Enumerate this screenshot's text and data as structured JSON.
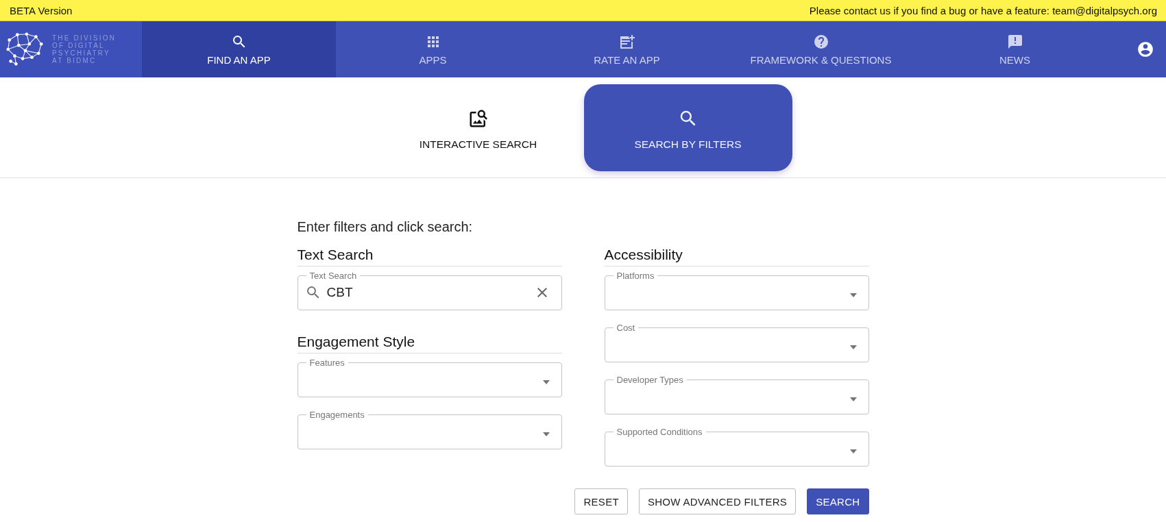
{
  "banner": {
    "label": "BETA Version",
    "message": "Please contact us if you find a bug or have a feature: team@digitalpsych.org"
  },
  "logo": {
    "lines": [
      "THE DIVISION",
      "OF DIGITAL",
      "PSYCHIATRY",
      "AT BIDMC"
    ]
  },
  "nav": [
    {
      "label": "FIND AN APP",
      "kind": "search",
      "selected": true
    },
    {
      "label": "APPS",
      "kind": "grid",
      "selected": false
    },
    {
      "label": "RATE AN APP",
      "kind": "rate",
      "selected": false
    },
    {
      "label": "FRAMEWORK & QUESTIONS",
      "kind": "help",
      "selected": false
    },
    {
      "label": "NEWS",
      "kind": "news",
      "selected": false
    }
  ],
  "modes": [
    {
      "label": "INTERACTIVE SEARCH",
      "kind": "interactive",
      "selected": false
    },
    {
      "label": "SEARCH BY FILTERS",
      "kind": "filters",
      "selected": true
    }
  ],
  "form": {
    "prompt": "Enter filters and click search:",
    "columns": [
      {
        "sections": [
          {
            "heading": "Text Search",
            "fields": [
              {
                "kind": "text",
                "label": "Text Search",
                "value": "CBT"
              }
            ]
          },
          {
            "heading": "Engagement Style",
            "fields": [
              {
                "kind": "select",
                "label": "Features"
              },
              {
                "kind": "select",
                "label": "Engagements"
              }
            ]
          }
        ]
      },
      {
        "sections": [
          {
            "heading": "Accessibility",
            "fields": [
              {
                "kind": "select",
                "label": "Platforms"
              },
              {
                "kind": "select",
                "label": "Cost"
              },
              {
                "kind": "select",
                "label": "Developer Types"
              },
              {
                "kind": "select",
                "label": "Supported Conditions"
              }
            ]
          }
        ]
      }
    ]
  },
  "buttons": [
    {
      "label": "RESET",
      "kind": "outlined"
    },
    {
      "label": "SHOW ADVANCED FILTERS",
      "kind": "outlined"
    },
    {
      "label": "SEARCH",
      "kind": "primary"
    }
  ]
}
